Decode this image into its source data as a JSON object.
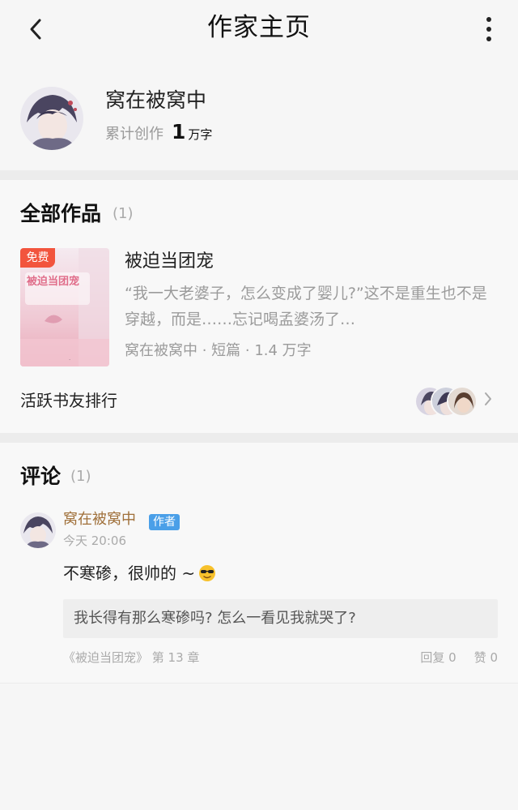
{
  "header": {
    "title": "作家主页"
  },
  "author": {
    "name": "窝在被窝中",
    "stat_label": "累计创作",
    "stat_number": "1",
    "stat_unit": "万字"
  },
  "works": {
    "title": "全部作品",
    "count": "(1)",
    "book": {
      "badge": "免费",
      "cover_title": "被迫当团宠",
      "title": "被迫当团宠",
      "description": "“我一大老婆子，怎么变成了婴儿?”这不是重生也不是穿越，而是……忘记喝孟婆汤了…",
      "meta": "窝在被窝中 · 短篇 · 1.4 万字"
    },
    "rank_label": "活跃书友排行"
  },
  "comments": {
    "title": "评论",
    "count": "(1)",
    "items": [
      {
        "user": "窝在被窝中",
        "tag": "作者",
        "time": "今天 20:06",
        "body": "不寒碜，很帅的 ~",
        "quote": "我长得有那么寒碜吗? 怎么一看见我就哭了?",
        "source": "《被迫当团宠》 第 13 章",
        "reply": "回复 0",
        "like": "赞 0"
      }
    ]
  },
  "colors": {
    "free_badge": "#f2543d",
    "author_tag": "#4a9fe8",
    "username": "#a0703a"
  }
}
